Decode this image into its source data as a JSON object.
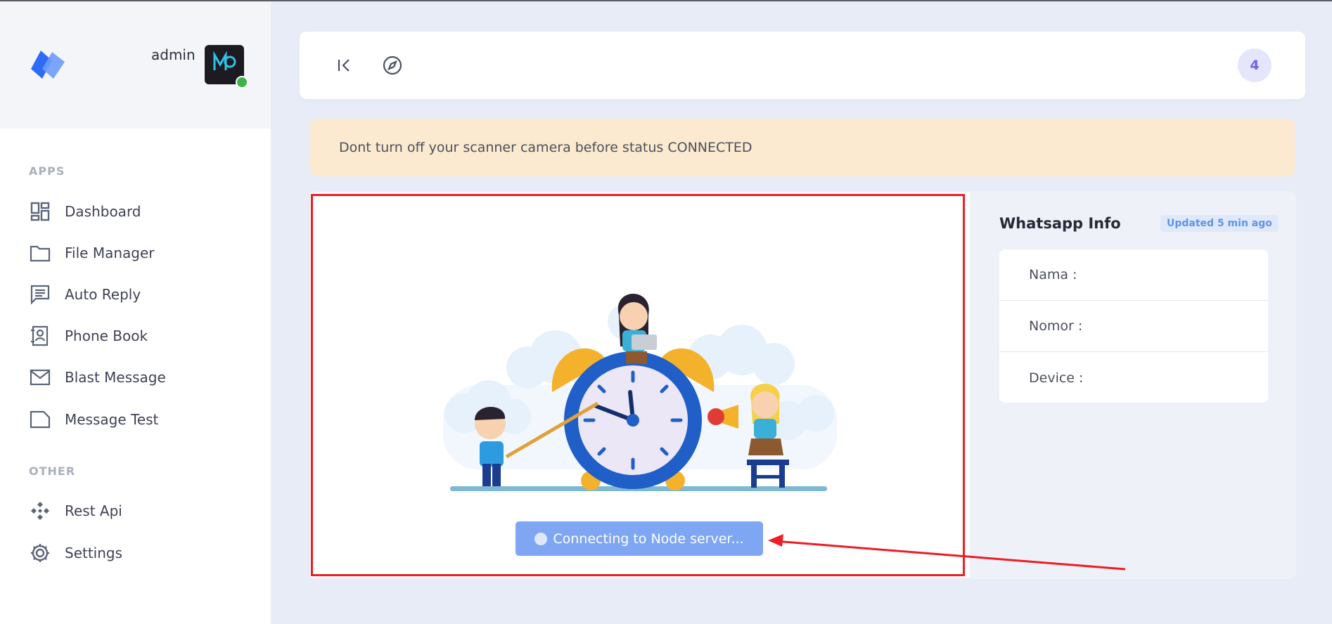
{
  "user": {
    "name": "admin"
  },
  "sidebar": {
    "sections": [
      {
        "label": "APPS"
      },
      {
        "label": "OTHER"
      }
    ],
    "apps_items": [
      {
        "label": "Dashboard",
        "icon": "dashboard-icon"
      },
      {
        "label": "File Manager",
        "icon": "folder-icon"
      },
      {
        "label": "Auto Reply",
        "icon": "chat-icon"
      },
      {
        "label": "Phone Book",
        "icon": "contact-book-icon"
      },
      {
        "label": "Blast Message",
        "icon": "mail-icon"
      },
      {
        "label": "Message Test",
        "icon": "document-icon"
      }
    ],
    "other_items": [
      {
        "label": "Rest Api",
        "icon": "api-icon"
      },
      {
        "label": "Settings",
        "icon": "gear-icon"
      }
    ]
  },
  "topbar": {
    "notification_count": "4"
  },
  "alert": {
    "text": "Dont turn off your scanner camera before status CONNECTED"
  },
  "scanner": {
    "button_label": "Connecting to Node server..."
  },
  "whatsapp_info": {
    "title": "Whatsapp Info",
    "updated": "Updated 5 min ago",
    "rows": [
      {
        "label": "Nama :"
      },
      {
        "label": "Nomor :"
      },
      {
        "label": "Device :"
      }
    ]
  },
  "colors": {
    "primary": "#7ea6f3",
    "alert_bg": "#fbead0",
    "highlight": "#ee1c25",
    "online": "#3bb54a"
  }
}
